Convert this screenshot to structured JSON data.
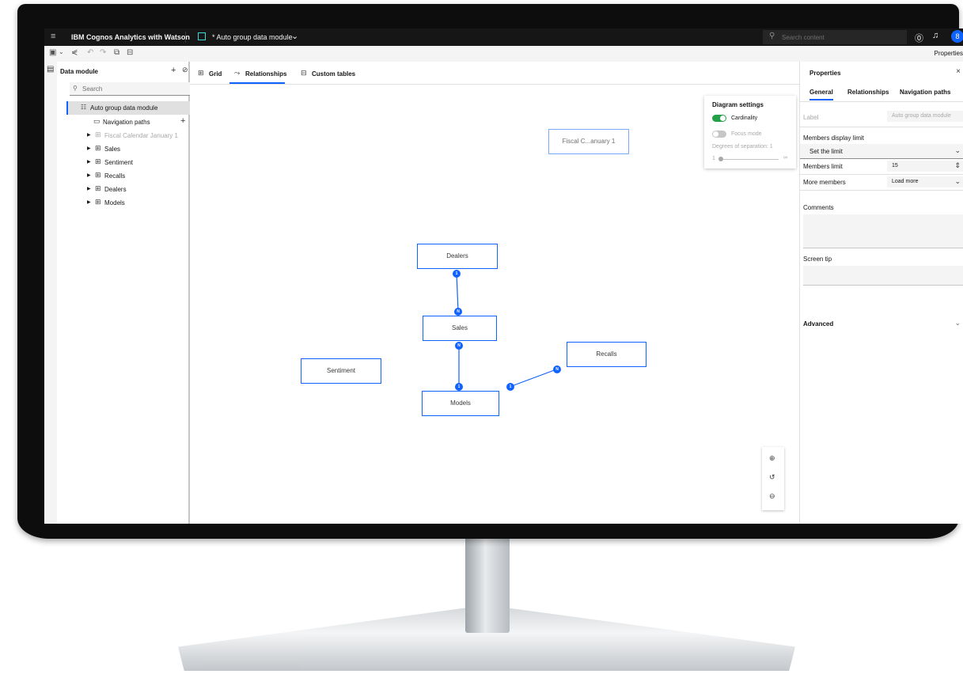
{
  "header": {
    "brand": "IBM Cognos Analytics with Watson",
    "module_title": "* Auto group data module",
    "search_placeholder": "Search content",
    "avatar_initial": "8"
  },
  "toolbar": {
    "properties_label": "Properties"
  },
  "data_module_panel": {
    "title": "Data module",
    "search_placeholder": "Search",
    "root": "Auto group data module",
    "navigation_paths": "Navigation paths",
    "items": [
      {
        "label": "Fiscal Calendar January 1",
        "disabled": true
      },
      {
        "label": "Sales"
      },
      {
        "label": "Sentiment"
      },
      {
        "label": "Recalls"
      },
      {
        "label": "Dealers"
      },
      {
        "label": "Models"
      }
    ]
  },
  "tabs": {
    "grid": "Grid",
    "relationships": "Relationships",
    "custom_tables": "Custom tables",
    "active": "Relationships"
  },
  "diagram": {
    "nodes": {
      "fiscal": "Fiscal C...anuary 1",
      "dealers": "Dealers",
      "sales": "Sales",
      "recalls": "Recalls",
      "sentiment": "Sentiment",
      "models": "Models"
    },
    "relationships": [
      {
        "from": "Dealers",
        "to": "Sales",
        "from_card": "1",
        "to_card": "N"
      },
      {
        "from": "Sales",
        "to": "Models",
        "from_card": "N",
        "to_card": "1"
      },
      {
        "from": "Models",
        "to": "Recalls",
        "from_card": "1",
        "to_card": "N"
      }
    ],
    "cardinality": {
      "one": "1",
      "many": "N"
    },
    "settings": {
      "title": "Diagram settings",
      "cardinality_label": "Cardinality",
      "cardinality_on": true,
      "focus_mode_label": "Focus mode",
      "focus_mode_on": false,
      "degrees_label": "Degrees of separation: 1",
      "slider_min": "1",
      "slider_max": "∞",
      "slider_value": 1
    }
  },
  "properties": {
    "title": "Properties",
    "tabs": [
      "General",
      "Relationships",
      "Navigation paths"
    ],
    "active_tab": "General",
    "label_key": "Label",
    "label_value": "Auto group data module",
    "members_display_limit": "Members display limit",
    "set_the_limit": "Set the limit",
    "members_limit_key": "Members limit",
    "members_limit_value": "15",
    "more_members_key": "More members",
    "more_members_value": "Load more",
    "comments": "Comments",
    "screen_tip": "Screen tip",
    "advanced": "Advanced"
  },
  "colors": {
    "accent": "#0f62fe",
    "toggle_on": "#24a148",
    "header_bg": "#161616"
  }
}
